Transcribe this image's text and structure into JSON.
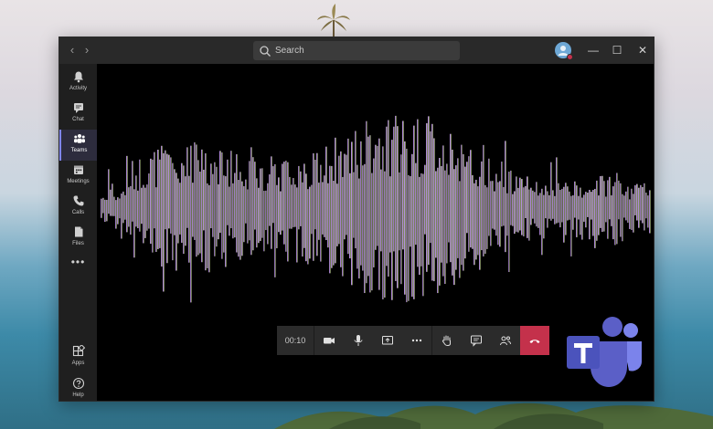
{
  "titlebar": {
    "search_placeholder": "Search",
    "nav_back_icon": "chevron-left-icon",
    "nav_forward_icon": "chevron-right-icon"
  },
  "sidebar": {
    "items": [
      {
        "label": "Activity",
        "icon": "bell-icon"
      },
      {
        "label": "Chat",
        "icon": "chat-icon"
      },
      {
        "label": "Teams",
        "icon": "teams-icon",
        "active": true
      },
      {
        "label": "Meetings",
        "icon": "calendar-icon"
      },
      {
        "label": "Calls",
        "icon": "phone-icon"
      },
      {
        "label": "Files",
        "icon": "file-icon"
      }
    ],
    "more": "•••",
    "bottom_items": [
      {
        "label": "Apps",
        "icon": "apps-icon"
      },
      {
        "label": "Help",
        "icon": "help-icon"
      }
    ]
  },
  "call": {
    "timer": "00:10"
  },
  "colors": {
    "accent": "#7f85f5",
    "hangup": "#c4314b",
    "titlebar": "#292929",
    "sidebar": "#1f1f1f"
  }
}
